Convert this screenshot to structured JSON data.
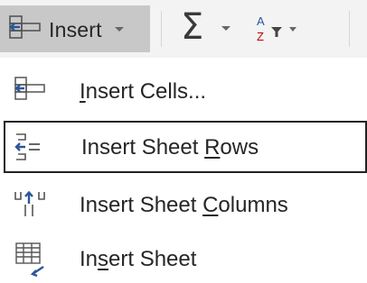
{
  "ribbon": {
    "insert_label": "Insert",
    "insert_icon": "insert-cells-icon",
    "autosum_icon": "sigma-icon",
    "sort_filter_icon": "sort-az-filter-icon",
    "dropdown_icon": "chevron-down-icon"
  },
  "menu": {
    "items": [
      {
        "pre": "",
        "key": "I",
        "post": "nsert Cells...",
        "icon": "insert-cells-icon"
      },
      {
        "pre": "Insert Sheet ",
        "key": "R",
        "post": "ows",
        "icon": "insert-rows-icon",
        "highlighted": true
      },
      {
        "pre": "Insert Sheet ",
        "key": "C",
        "post": "olumns",
        "icon": "insert-columns-icon"
      },
      {
        "pre": "In",
        "key": "s",
        "post": "ert Sheet",
        "icon": "insert-sheet-icon"
      }
    ]
  },
  "colors": {
    "ribbon_bg": "#f3f3f3",
    "button_hover": "#c8c8c8",
    "text": "#262626",
    "icon_blue": "#2b579a",
    "highlight_border": "#222222"
  }
}
